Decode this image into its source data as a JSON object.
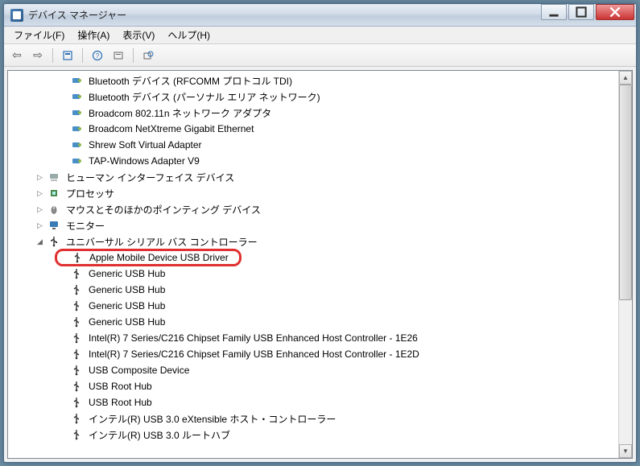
{
  "window": {
    "title": "デバイス マネージャー"
  },
  "menu": {
    "file": "ファイル(F)",
    "action": "操作(A)",
    "view": "表示(V)",
    "help": "ヘルプ(H)"
  },
  "toolbar": {
    "back": "←",
    "forward": "→",
    "props": "properties",
    "help": "?",
    "scan": "scan",
    "showhidden": "show-hidden"
  },
  "tree": {
    "networkAdapters": [
      "Bluetooth デバイス (RFCOMM プロトコル TDI)",
      "Bluetooth デバイス (パーソナル エリア ネットワーク)",
      "Broadcom 802.11n ネットワーク アダプタ",
      "Broadcom NetXtreme Gigabit Ethernet",
      "Shrew Soft Virtual Adapter",
      "TAP-Windows Adapter V9"
    ],
    "hid": "ヒューマン インターフェイス デバイス",
    "cpu": "プロセッサ",
    "mouse": "マウスとそのほかのポインティング デバイス",
    "monitor": "モニター",
    "usbController": "ユニバーサル シリアル バス コントローラー",
    "usbItems": [
      "Apple Mobile Device USB Driver",
      "Generic USB Hub",
      "Generic USB Hub",
      "Generic USB Hub",
      "Generic USB Hub",
      "Intel(R) 7 Series/C216 Chipset Family USB Enhanced Host Controller - 1E26",
      "Intel(R) 7 Series/C216 Chipset Family USB Enhanced Host Controller - 1E2D",
      "USB Composite Device",
      "USB Root Hub",
      "USB Root Hub",
      "インテル(R) USB 3.0 eXtensible ホスト・コントローラー",
      "インテル(R) USB 3.0 ルートハブ"
    ]
  }
}
